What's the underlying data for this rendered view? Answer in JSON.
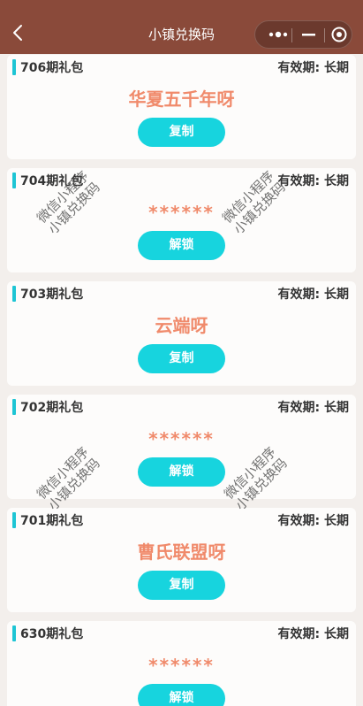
{
  "nav": {
    "title": "小镇兑换码",
    "bg_color": "#8a4a3a",
    "icons": [
      "chevron-left-icon",
      "more-dots-icon",
      "minus-icon",
      "target-circle-icon"
    ]
  },
  "colors": {
    "accent_bar": "#1ec5d4",
    "button": "#17d4de",
    "code_text": "#f08a6b"
  },
  "cards": [
    {
      "name": "706期礼包",
      "validity": "有效期: 长期",
      "code": "华夏五千年呀",
      "button": "复制"
    },
    {
      "name": "704期礼包",
      "validity": "有效期: 长期",
      "code": "******",
      "button": "解锁"
    },
    {
      "name": "703期礼包",
      "validity": "有效期: 长期",
      "code": "云端呀",
      "button": "复制"
    },
    {
      "name": "702期礼包",
      "validity": "有效期: 长期",
      "code": "******",
      "button": "解锁"
    },
    {
      "name": "701期礼包",
      "validity": "有效期: 长期",
      "code": "曹氏联盟呀",
      "button": "复制"
    },
    {
      "name": "630期礼包",
      "validity": "有效期: 长期",
      "code": "******",
      "button": "解锁"
    }
  ],
  "watermark": {
    "line1": "微信小程序",
    "line2": "小镇兑换码"
  }
}
